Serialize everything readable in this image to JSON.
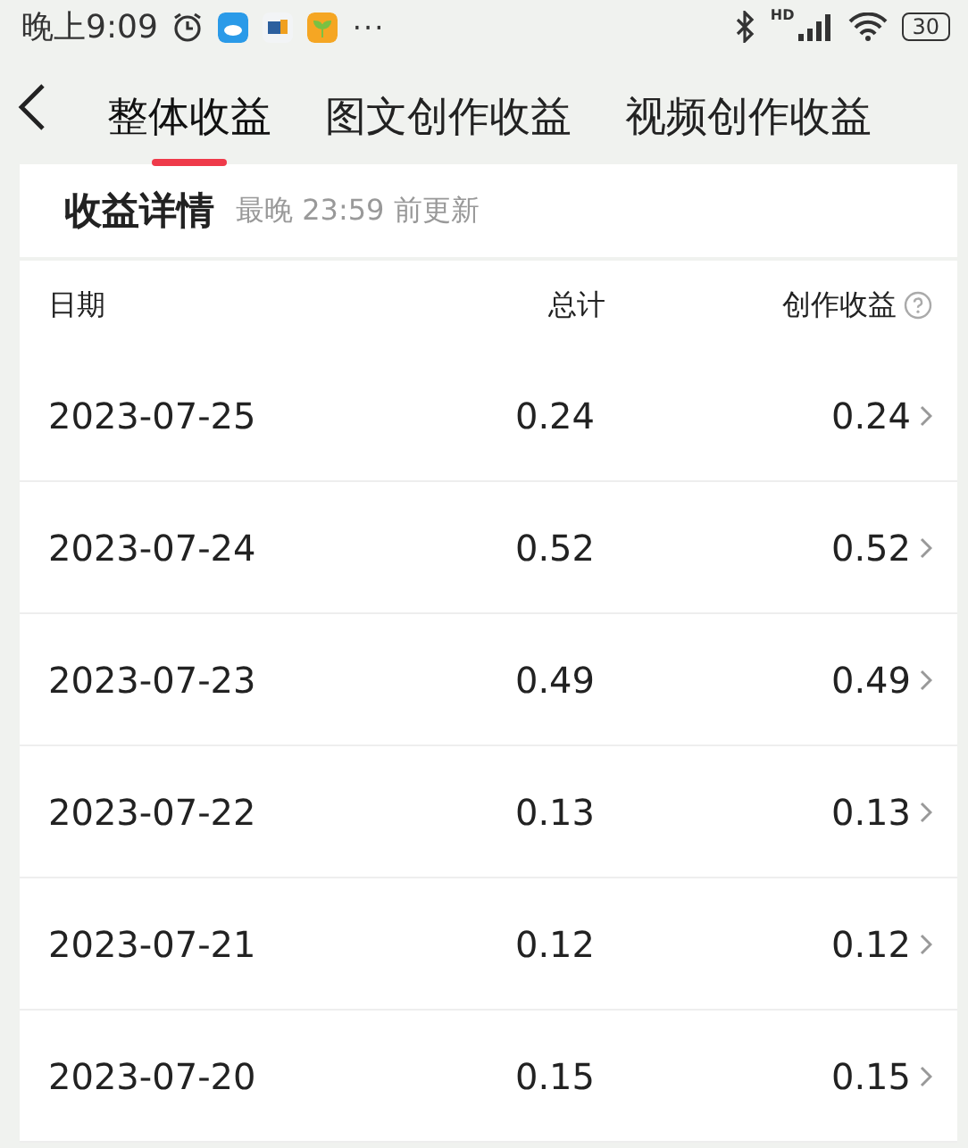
{
  "status_bar": {
    "time": "晚上9:09",
    "more": "···",
    "network": "HD",
    "battery": "30"
  },
  "tabs": [
    {
      "label": "整体收益",
      "selected": true
    },
    {
      "label": "图文创作收益",
      "selected": false
    },
    {
      "label": "视频创作收益",
      "selected": false
    }
  ],
  "details": {
    "title": "收益详情",
    "note": "最晚 23:59 前更新"
  },
  "table": {
    "columns": [
      "日期",
      "总计",
      "创作收益"
    ],
    "rows": [
      {
        "date": "2023-07-25",
        "total": "0.24",
        "creation": "0.24"
      },
      {
        "date": "2023-07-24",
        "total": "0.52",
        "creation": "0.52"
      },
      {
        "date": "2023-07-23",
        "total": "0.49",
        "creation": "0.49"
      },
      {
        "date": "2023-07-22",
        "total": "0.13",
        "creation": "0.13"
      },
      {
        "date": "2023-07-21",
        "total": "0.12",
        "creation": "0.12"
      },
      {
        "date": "2023-07-20",
        "total": "0.15",
        "creation": "0.15"
      }
    ]
  }
}
